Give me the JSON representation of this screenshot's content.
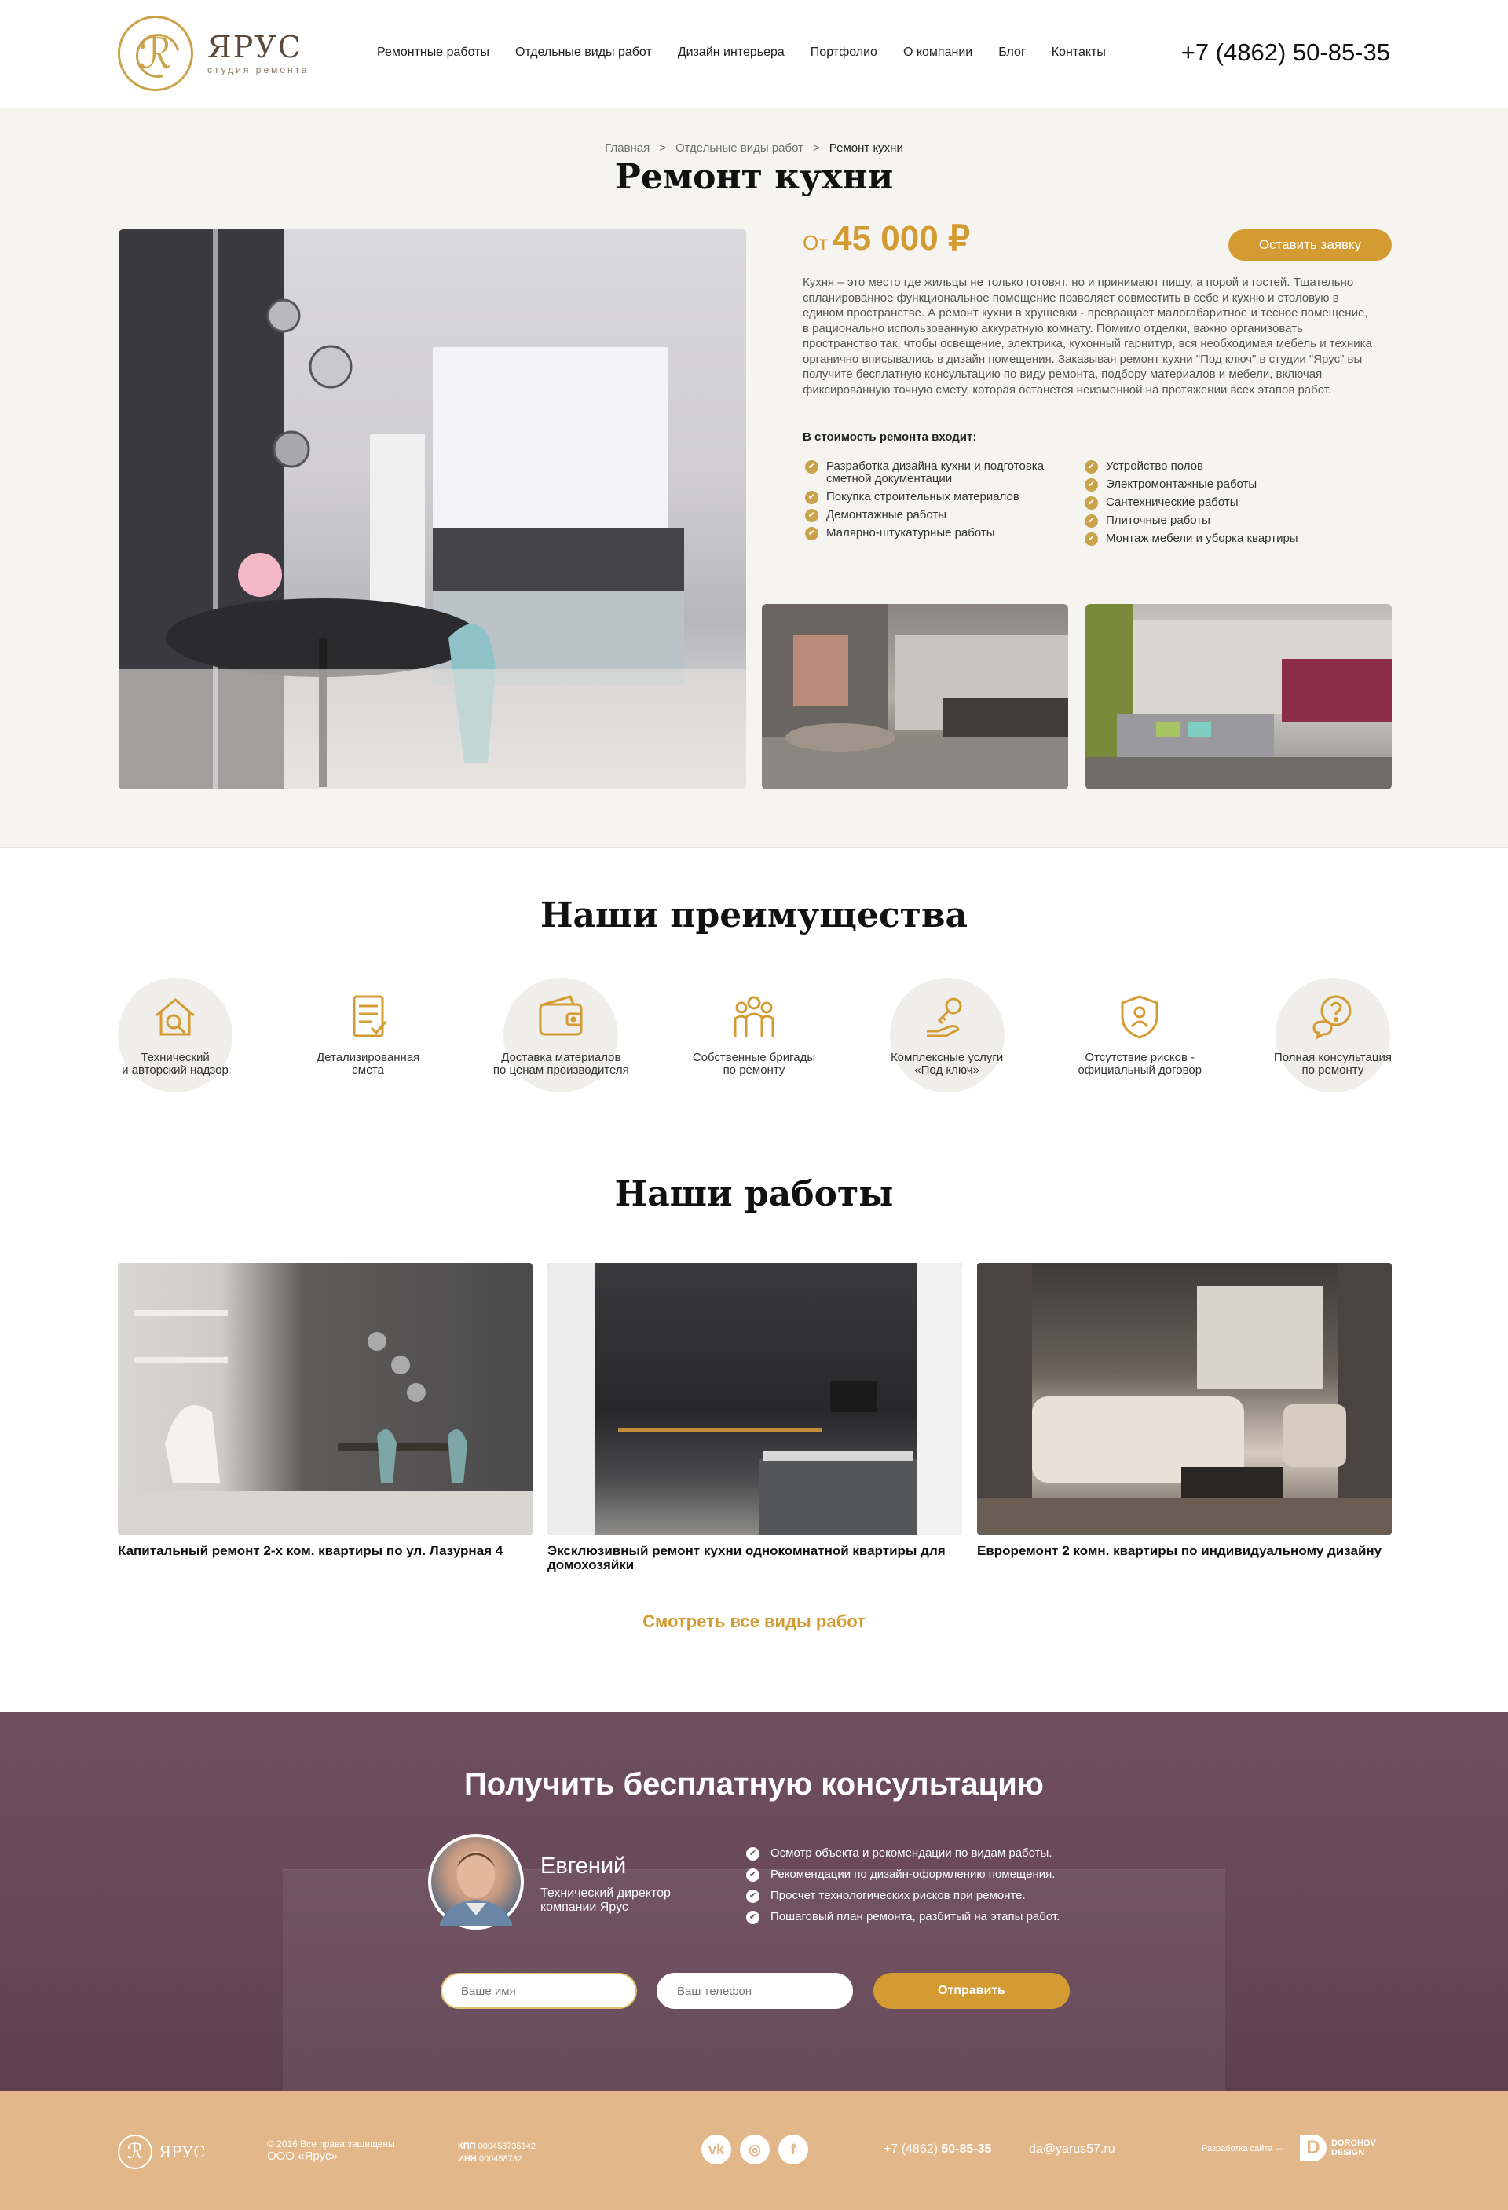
{
  "header": {
    "logo_name": "ЯРУС",
    "logo_sub": "студия ремонта",
    "nav": [
      "Ремонтные работы",
      "Отдельные виды работ",
      "Дизайн интерьера",
      "Портфолио",
      "О компании",
      "Блог",
      "Контакты"
    ],
    "phone": "+7 (4862) 50-85-35"
  },
  "breadcrumb": [
    "Главная",
    "Отдельные виды работ",
    "Ремонт кухни"
  ],
  "page_title": "Ремонт кухни",
  "hero": {
    "price_prefix": "От",
    "price_value": "45 000 ₽",
    "order_button": "Оставить заявку",
    "description": "Кухня – это место где жильцы не только готовят, но и принимают пищу, а порой и гостей. Тщательно спланированное функциональное помещение позволяет совместить в себе и кухню и столовую в едином пространстве. А ремонт кухни в хрущевки - превращает малогабаритное и тесное помещение, в рационально использованную аккуратную комнату. Помимо отделки, важно организовать пространство так, чтобы освещение, электрика, кухонный гарнитур, вся необходимая мебель и техника органично вписывались в дизайн помещения. Заказывая ремонт кухни \"Под ключ\" в студии \"Ярус\" вы получите бесплатную консультацию по виду ремонта, подбору материалов и мебели, включая фиксированную точную смету, которая останется неизменной на протяжении всех этапов работ.",
    "includes_title": "В стоимость ремонта входит:",
    "includes_left": [
      "Разработка дизайна кухни и подготовка сметной документации",
      "Покупка строительных материалов",
      "Демонтажные работы",
      "Малярно-штукатурные работы"
    ],
    "includes_right": [
      "Устройство полов",
      "Электромонтажные работы",
      "Сантехнические работы",
      "Плиточные работы",
      "Монтаж мебели и уборка квартиры"
    ]
  },
  "advantages": {
    "title": "Наши преимущества",
    "items": [
      {
        "label": "Технический\nи авторский надзор",
        "icon": "house-search-icon",
        "circle": true
      },
      {
        "label": "Детализированная\nсмета",
        "icon": "document-list-icon",
        "circle": false
      },
      {
        "label": "Доставка материалов\nпо ценам производителя",
        "icon": "wallet-icon",
        "circle": true
      },
      {
        "label": "Собственные бригады\nпо ремонту",
        "icon": "team-icon",
        "circle": false
      },
      {
        "label": "Комплексные услуги\n«Под ключ»",
        "icon": "hand-key-icon",
        "circle": true
      },
      {
        "label": "Отсутствие рисков -\nофициальный договор",
        "icon": "shield-user-icon",
        "circle": false
      },
      {
        "label": "Полная консультация\nпо ремонту",
        "icon": "chat-question-icon",
        "circle": true
      }
    ]
  },
  "works": {
    "title": "Наши работы",
    "items": [
      {
        "caption": "Капитальный ремонт 2-х ком. квартиры по ул. Лазурная 4"
      },
      {
        "caption": "Эксклюзивный ремонт кухни однокомнатной квартиры для домохозяйки"
      },
      {
        "caption": "Евроремонт 2 комн. квартиры по индивидуальному дизайну"
      }
    ],
    "all_link": "Смотреть все виды работ"
  },
  "consult": {
    "title": "Получить бесплатную консультацию",
    "person_name": "Евгений",
    "person_role": "Технический директор компании Ярус",
    "benefits": [
      "Осмотр объекта и рекомендации по видам работы.",
      "Рекомендации по дизайн-оформлению помещения.",
      "Просчет технологических рисков при ремонте.",
      "Пошаговый план ремонта, разбитый на этапы работ."
    ],
    "name_placeholder": "Ваше имя",
    "phone_placeholder": "Ваш телефон",
    "send_button": "Отправить"
  },
  "footer": {
    "logo_name": "ЯРУС",
    "copy_line1": "© 2016 Все права защищены",
    "copy_line2": "ООО «Ярус»",
    "kpp_label": "КПП",
    "kpp_value": "000458735142",
    "inn_label": "ИНН",
    "inn_value": "000458732",
    "social": [
      "vk-icon",
      "instagram-icon",
      "facebook-icon"
    ],
    "phone_prefix": "+7 (4862)",
    "phone_number": "50-85-35",
    "email": "da@yarus57.ru",
    "dev_label": "Разработка сайта —",
    "dev_name_line1": "DOROHOV",
    "dev_name_line2": "DESIGN"
  },
  "colors": {
    "accent": "#d49b32",
    "consult_bg": "#6a4a5a",
    "footer_bg": "#e2b789"
  }
}
